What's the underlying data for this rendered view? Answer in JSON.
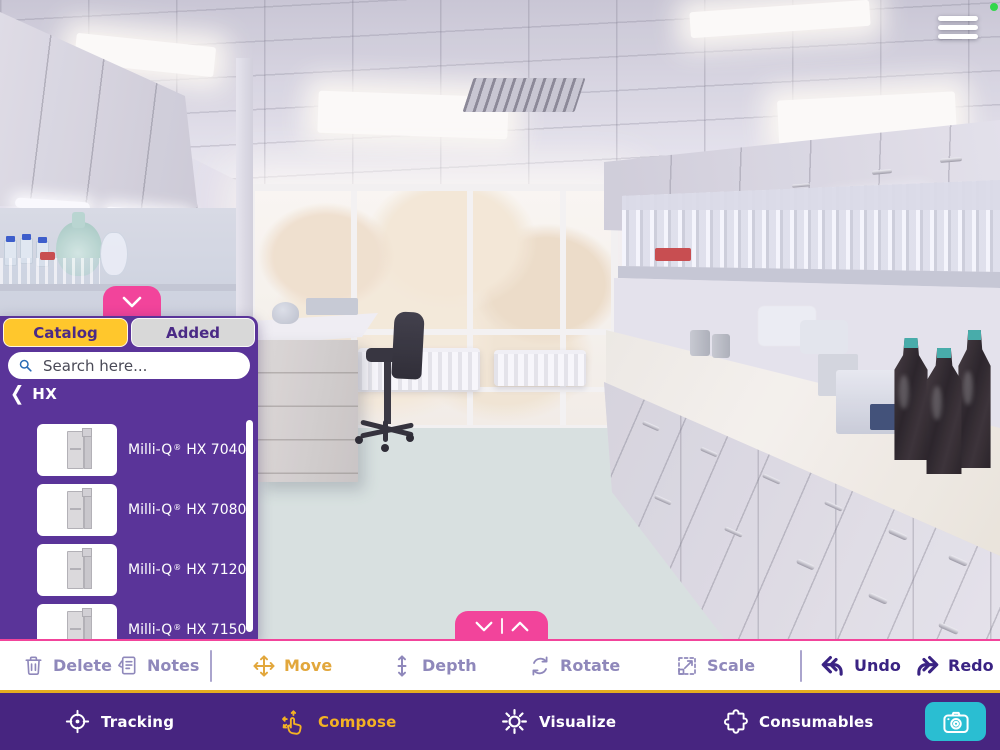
{
  "app": {
    "recording_indicator_color": "#32d74b"
  },
  "colors": {
    "panel_purple": "#5a3499",
    "nav_purple": "#472580",
    "accent_pink": "#f2449b",
    "accent_gold": "#ffc72c",
    "active_tool_gold": "#e2a73c",
    "tab_inactive_gray": "#d8d8d8",
    "camera_teal": "#2abed2",
    "toolbar_inactive": "#8f88bb",
    "undo_redo_purple": "#3a2383"
  },
  "catalog_panel": {
    "tabs": [
      {
        "label": "Catalog",
        "active": true
      },
      {
        "label": "Added",
        "active": false
      }
    ],
    "search_placeholder": "Search here...",
    "breadcrumb": {
      "back_chevron": "❮",
      "label": "HX"
    },
    "products": [
      {
        "brand": "Milli-Q",
        "reg": "®",
        "model": "HX 7040"
      },
      {
        "brand": "Milli-Q",
        "reg": "®",
        "model": "HX 7080"
      },
      {
        "brand": "Milli-Q",
        "reg": "®",
        "model": "HX 7120"
      },
      {
        "brand": "Milli-Q",
        "reg": "®",
        "model": "HX 7150"
      }
    ]
  },
  "edit_toolbar": {
    "delete": "Delete",
    "notes": "Notes",
    "move": "Move",
    "depth": "Depth",
    "rotate": "Rotate",
    "scale": "Scale",
    "undo": "Undo",
    "redo": "Redo",
    "active_tool": "Move"
  },
  "bottom_nav": {
    "tracking": "Tracking",
    "compose": "Compose",
    "visualize": "Visualize",
    "consumables": "Consumables",
    "active_tab": "Compose"
  }
}
